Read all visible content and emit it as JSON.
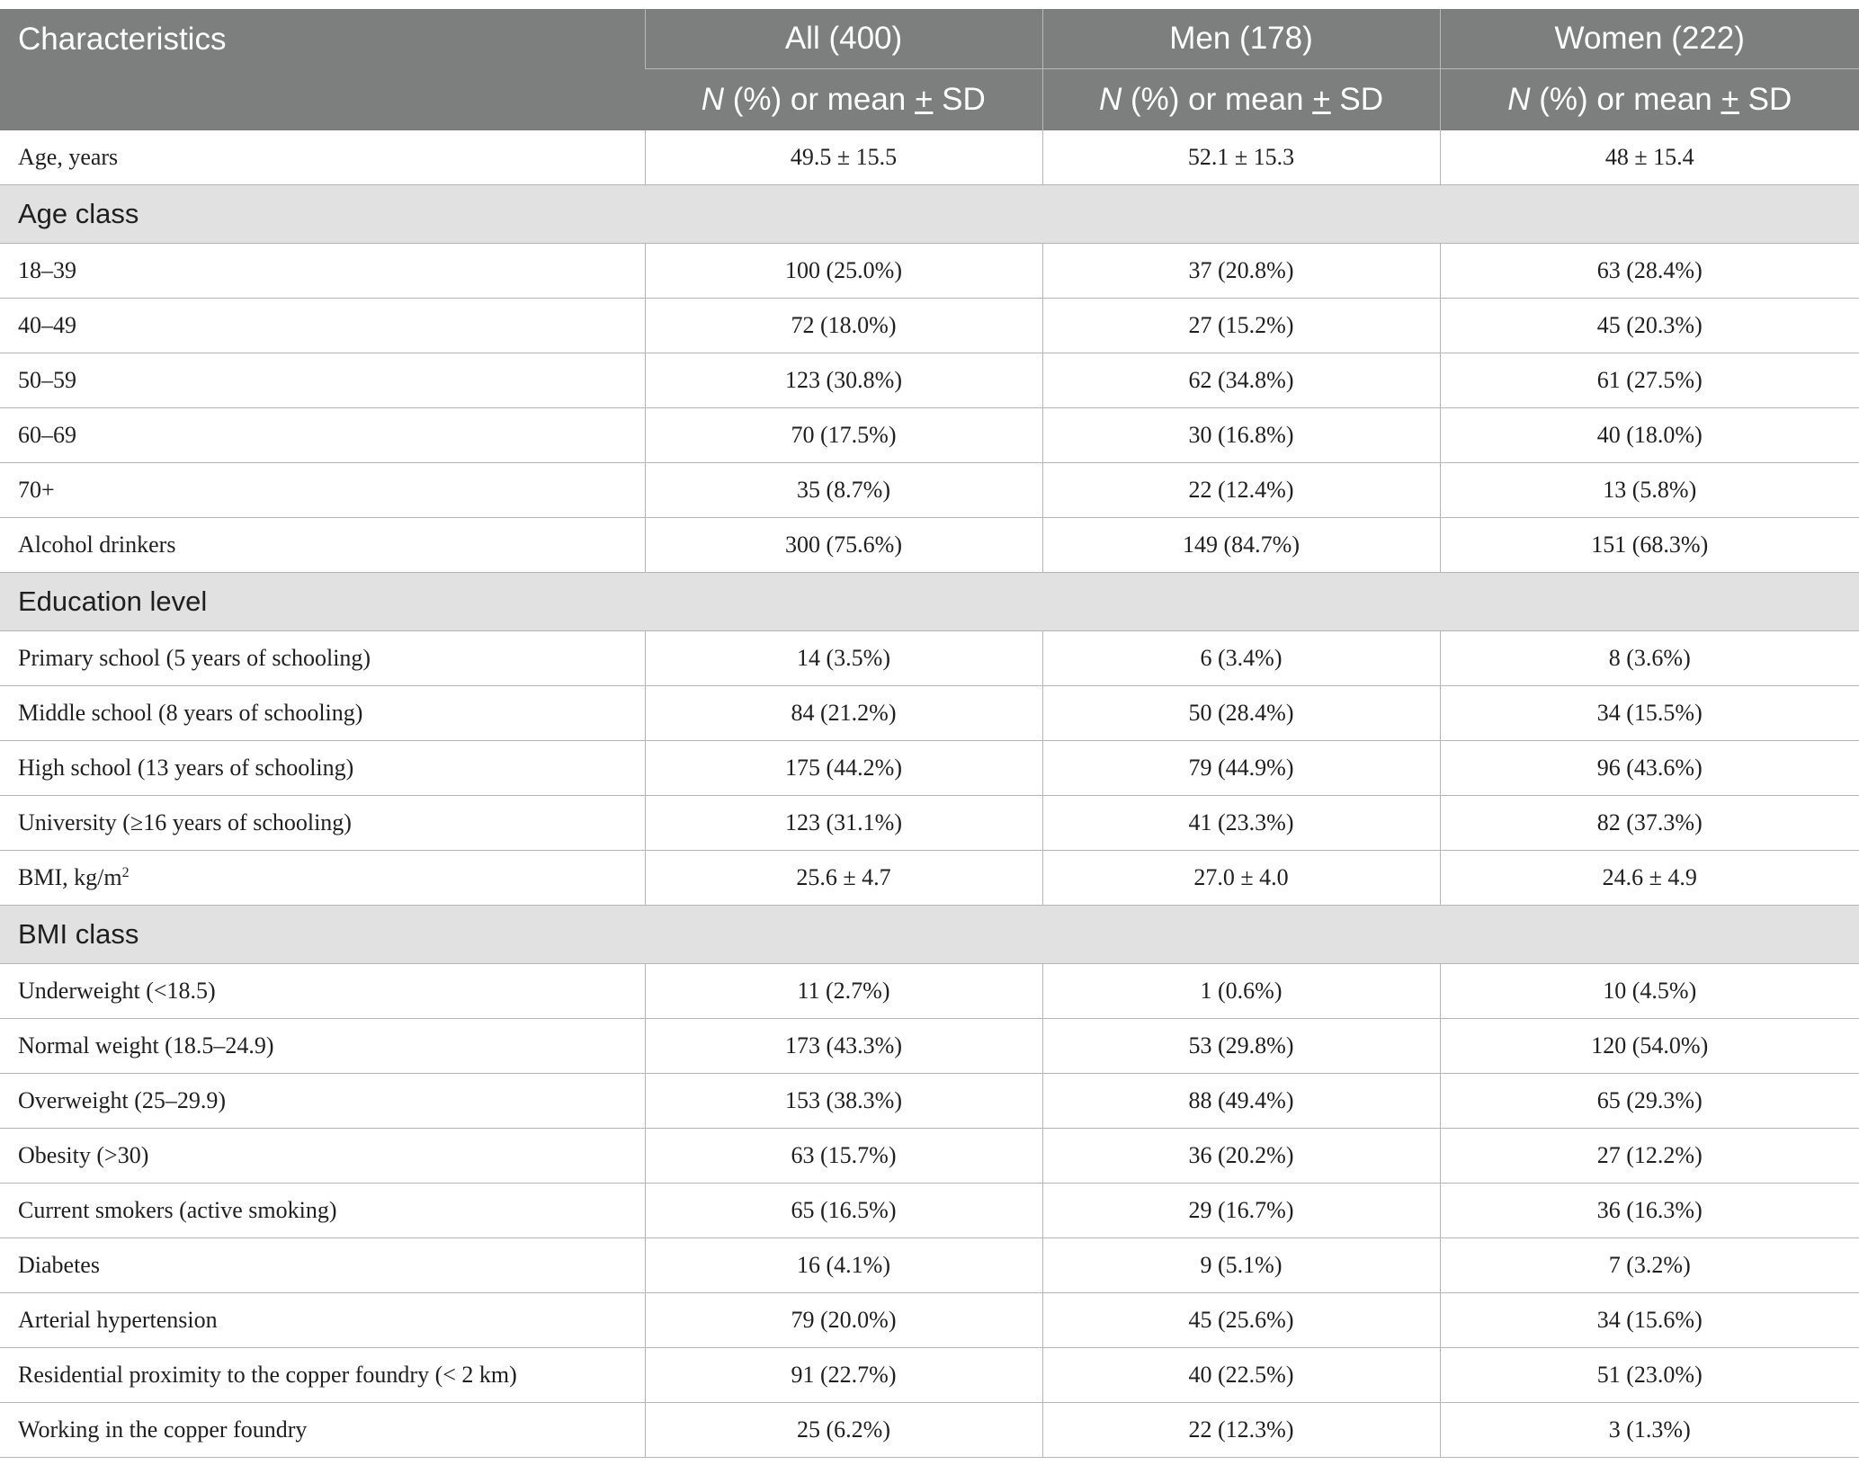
{
  "header": {
    "characteristics": "Characteristics",
    "groups": [
      "All (400)",
      "Men (178)",
      "Women (222)"
    ],
    "subheader": {
      "n": "N",
      "pct_or_mean": " (%) or mean ",
      "pm": "+",
      "sd": " SD"
    }
  },
  "rows": [
    {
      "type": "data",
      "label": "Age, years",
      "values": [
        "49.5 ± 15.5",
        "52.1 ± 15.3",
        "48 ± 15.4"
      ]
    },
    {
      "type": "section",
      "label": "Age class"
    },
    {
      "type": "data",
      "label": "18–39",
      "values": [
        "100 (25.0%)",
        "37 (20.8%)",
        "63 (28.4%)"
      ]
    },
    {
      "type": "data",
      "label": "40–49",
      "values": [
        "72 (18.0%)",
        "27 (15.2%)",
        "45 (20.3%)"
      ]
    },
    {
      "type": "data",
      "label": "50–59",
      "values": [
        "123 (30.8%)",
        "62 (34.8%)",
        "61 (27.5%)"
      ]
    },
    {
      "type": "data",
      "label": "60–69",
      "values": [
        "70 (17.5%)",
        "30 (16.8%)",
        "40 (18.0%)"
      ]
    },
    {
      "type": "data",
      "label": "70+",
      "values": [
        "35 (8.7%)",
        "22 (12.4%)",
        "13 (5.8%)"
      ]
    },
    {
      "type": "data",
      "label": "Alcohol drinkers",
      "values": [
        "300 (75.6%)",
        "149 (84.7%)",
        "151 (68.3%)"
      ]
    },
    {
      "type": "section",
      "label": "Education level"
    },
    {
      "type": "data",
      "label": "Primary school (5 years of schooling)",
      "values": [
        "14 (3.5%)",
        "6 (3.4%)",
        "8 (3.6%)"
      ]
    },
    {
      "type": "data",
      "label": "Middle school (8 years of schooling)",
      "values": [
        "84 (21.2%)",
        "50 (28.4%)",
        "34 (15.5%)"
      ]
    },
    {
      "type": "data",
      "label": "High school (13 years of schooling)",
      "values": [
        "175 (44.2%)",
        "79 (44.9%)",
        "96 (43.6%)"
      ]
    },
    {
      "type": "data",
      "label": "University (≥16 years of schooling)",
      "values": [
        "123 (31.1%)",
        "41 (23.3%)",
        "82 (37.3%)"
      ]
    },
    {
      "type": "data",
      "label": "BMI, kg/m",
      "label_sup": "2",
      "values": [
        "25.6 ± 4.7",
        "27.0 ± 4.0",
        "24.6 ± 4.9"
      ]
    },
    {
      "type": "section",
      "label": "BMI class"
    },
    {
      "type": "data",
      "label": "Underweight (<18.5)",
      "values": [
        "11 (2.7%)",
        "1 (0.6%)",
        "10 (4.5%)"
      ]
    },
    {
      "type": "data",
      "label": "Normal weight (18.5–24.9)",
      "values": [
        "173 (43.3%)",
        "53 (29.8%)",
        "120 (54.0%)"
      ]
    },
    {
      "type": "data",
      "label": "Overweight (25–29.9)",
      "values": [
        "153 (38.3%)",
        "88 (49.4%)",
        "65 (29.3%)"
      ]
    },
    {
      "type": "data",
      "label": "Obesity (>30)",
      "values": [
        "63 (15.7%)",
        "36 (20.2%)",
        "27 (12.2%)"
      ]
    },
    {
      "type": "data",
      "label": "Current smokers (active smoking)",
      "values": [
        "65 (16.5%)",
        "29 (16.7%)",
        "36 (16.3%)"
      ]
    },
    {
      "type": "data",
      "label": "Diabetes",
      "values": [
        "16 (4.1%)",
        "9 (5.1%)",
        "7 (3.2%)"
      ]
    },
    {
      "type": "data",
      "label": "Arterial hypertension",
      "values": [
        "79 (20.0%)",
        "45 (25.6%)",
        "34 (15.6%)"
      ]
    },
    {
      "type": "data",
      "label": "Residential proximity to the copper foundry (< 2 km)",
      "values": [
        "91 (22.7%)",
        "40 (22.5%)",
        "51 (23.0%)"
      ]
    },
    {
      "type": "data",
      "label": "Working in the copper foundry",
      "values": [
        "25 (6.2%)",
        "22 (12.3%)",
        "3 (1.3%)"
      ]
    }
  ]
}
